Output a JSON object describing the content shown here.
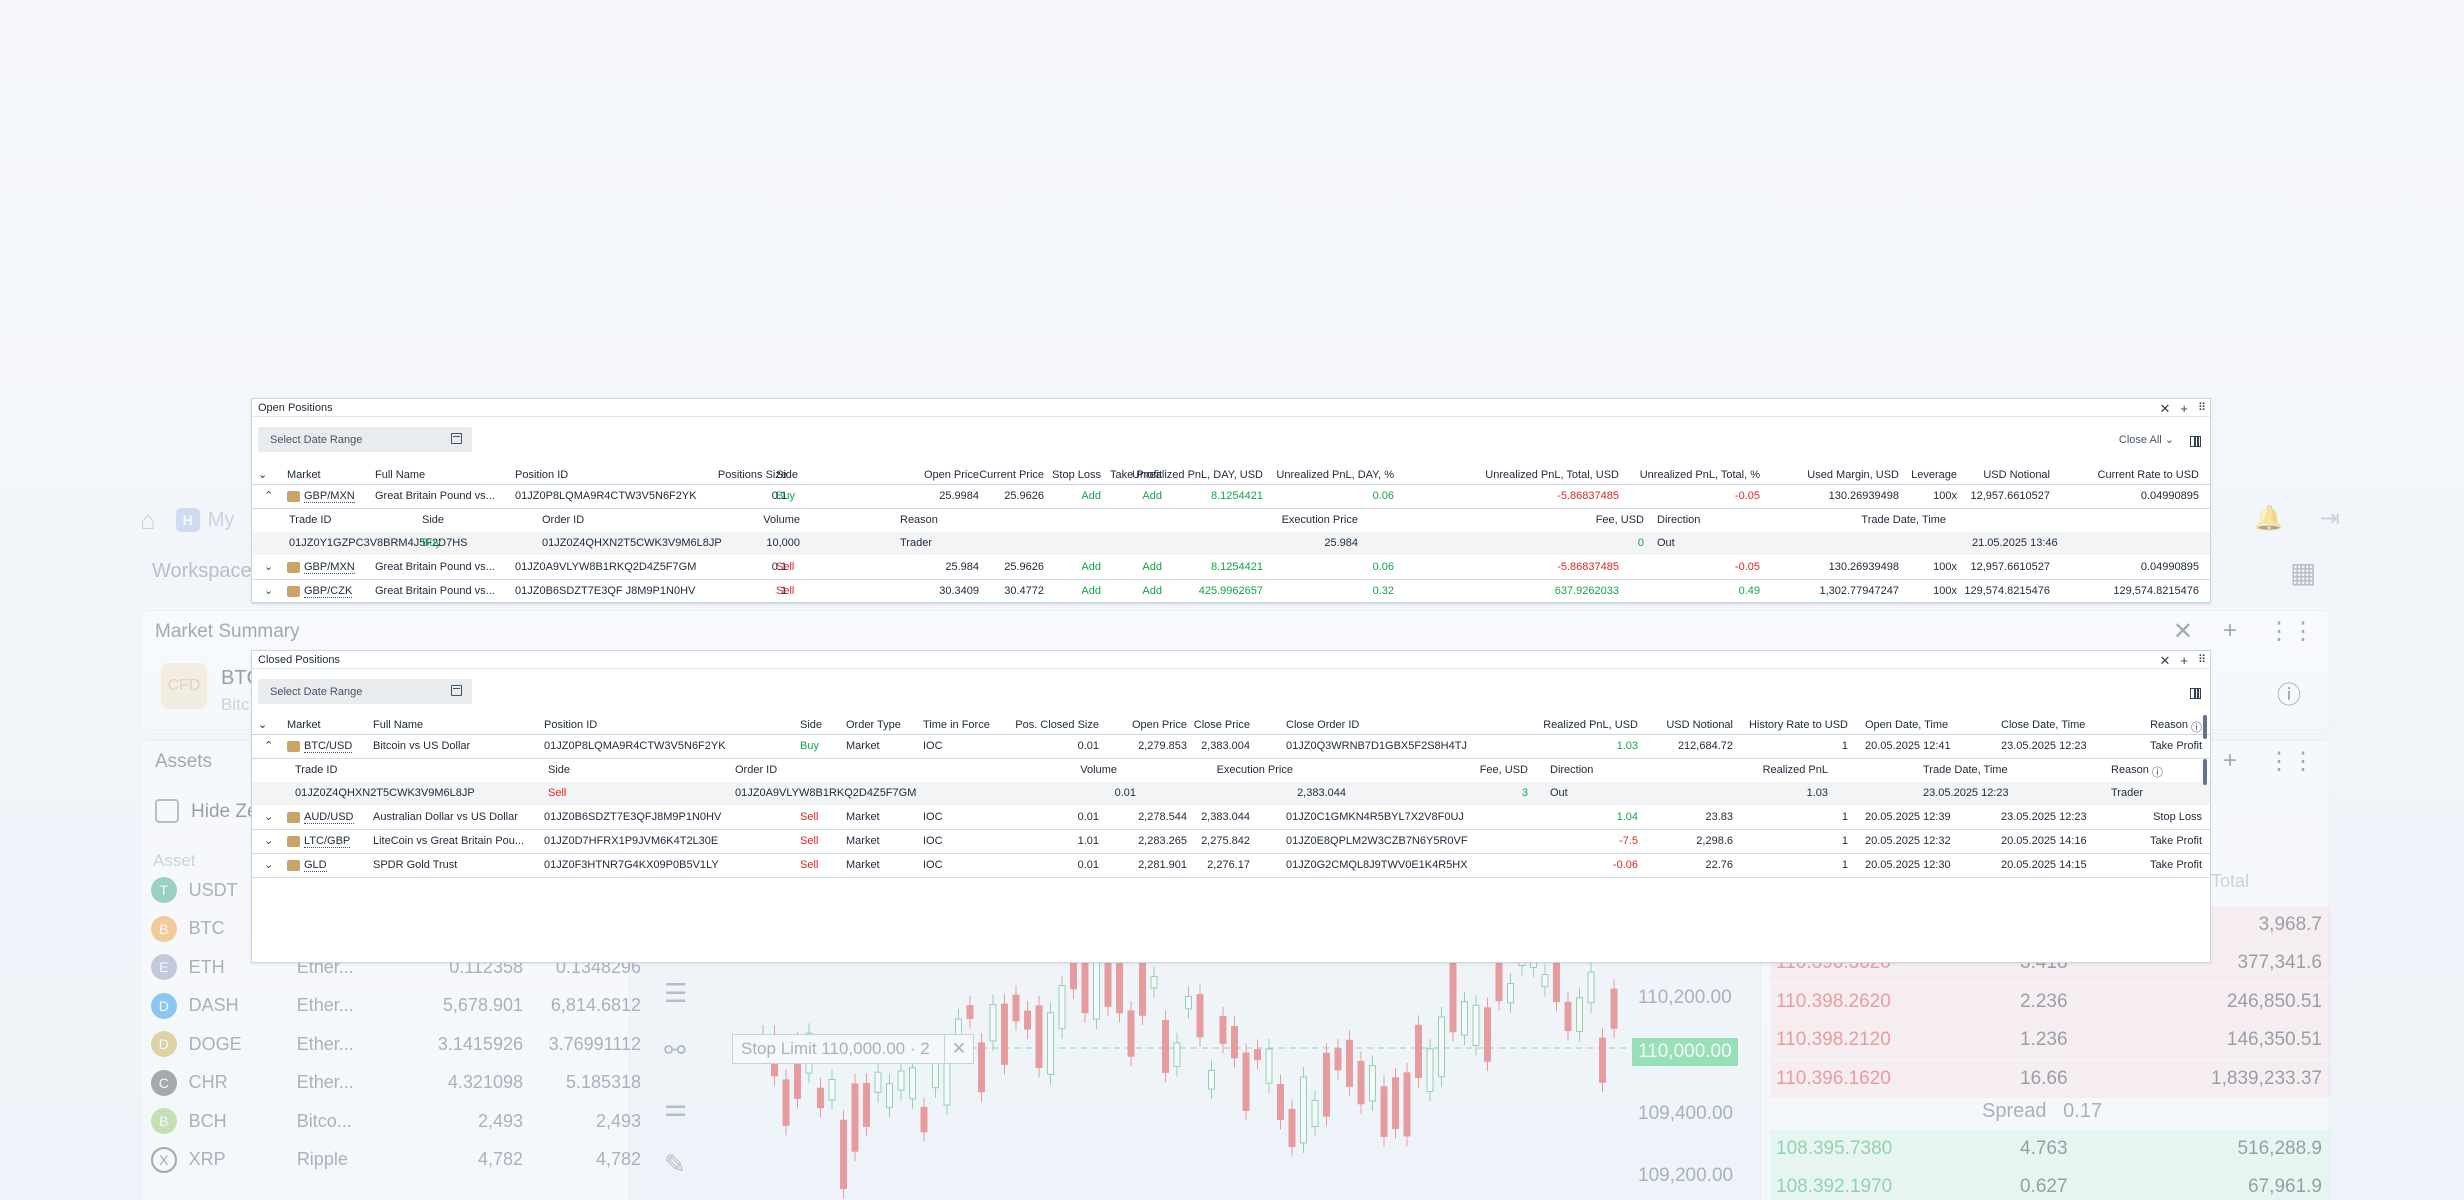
{
  "background": {
    "nav_my": "My",
    "workspace": "Workspace",
    "market_summary": "Market Summary",
    "summary_pair": "BTC",
    "summary_sub": "Bitc",
    "summary_badge": "CFD",
    "assets_title": "Assets",
    "hide_zero": "Hide Ze",
    "asset_col": "Asset",
    "total_col": "Total",
    "assets": [
      {
        "sym": "USDT",
        "net": "",
        "v1": "",
        "v2": "",
        "color": "#26a17b",
        "icon": "T"
      },
      {
        "sym": "BTC",
        "net": "",
        "v1": "",
        "v2": "",
        "color": "#f7931a",
        "icon": "B"
      },
      {
        "sym": "ETH",
        "net": "Ether...",
        "v1": "0.112358",
        "v2": "0.1348296",
        "color": "#8a92b2",
        "icon": "E"
      },
      {
        "sym": "DASH",
        "net": "Ether...",
        "v1": "5,678.901",
        "v2": "6,814.6812",
        "color": "#008ce7",
        "icon": "D"
      },
      {
        "sym": "DOGE",
        "net": "Ether...",
        "v1": "3.1415926",
        "v2": "3.76991112",
        "color": "#c2a633",
        "icon": "D"
      },
      {
        "sym": "CHR",
        "net": "Ether...",
        "v1": "4.321098",
        "v2": "5.185318",
        "color": "#444444",
        "icon": "C"
      },
      {
        "sym": "BCH",
        "net": "Bitco...",
        "v1": "2,493",
        "v2": "2,493",
        "color": "#8dc351",
        "icon": "B"
      },
      {
        "sym": "XRP",
        "net": "Ripple",
        "v1": "4,782",
        "v2": "4,782",
        "color": "#ffffff",
        "icon": "X"
      }
    ],
    "orderbook": [
      {
        "p": "",
        "q": "",
        "t": "3,968.7",
        "side": "ask"
      },
      {
        "p": "110.396.3620",
        "q": "3.418",
        "t": "377,341.6",
        "side": "ask"
      },
      {
        "p": "110.398.2620",
        "q": "2.236",
        "t": "246,850.51",
        "side": "ask"
      },
      {
        "p": "110.398.2120",
        "q": "1.236",
        "t": "146,350.51",
        "side": "ask"
      },
      {
        "p": "110.396.1620",
        "q": "16.66",
        "t": "1,839,233.37",
        "side": "ask"
      },
      {
        "p": "108.395.7380",
        "q": "4.763",
        "t": "516,288.9",
        "side": "bid"
      },
      {
        "p": "108.392.1970",
        "q": "0.627",
        "t": "67,961.9",
        "side": "bid"
      }
    ],
    "spread_label": "Spread",
    "spread_value": "0.17",
    "chart_prices": [
      "110,200.00",
      "110,000.00",
      "109,400.00",
      "109,200.00"
    ],
    "stop_limit_label": "Stop Limit 110,000.00 · 2"
  },
  "open_positions": {
    "title": "Open Positions",
    "date_range_placeholder": "Select Date Range",
    "close_all": "Close All",
    "headers": [
      "Market",
      "Full Name",
      "Position ID",
      "Side",
      "Positions Size",
      "Open Price",
      "Current Price",
      "Stop Loss",
      "Take Profit",
      "Unrealized PnL, DAY, USD",
      "Unrealized PnL, DAY, %",
      "Unrealized PnL, Total, USD",
      "Unrealized PnL, Total, %",
      "Used Margin, USD",
      "Leverage",
      "USD Notional",
      "Current Rate to USD"
    ],
    "rows": [
      {
        "market": "GBP/MXN",
        "full_name": "Great Britain Pound vs...",
        "position_id": "01JZ0P8LQMA9R4CTW3V5N6F2YK",
        "side": "Buy",
        "size": "0.1",
        "open_price": "25.9984",
        "current_price": "25.9626",
        "stop_loss": "Add",
        "take_profit": "Add",
        "pnl_day_usd": "8.1254421",
        "pnl_day_pct": "0.06",
        "pnl_total_usd": "-5.86837485",
        "pnl_total_pct": "-0.05",
        "used_margin": "130.26939498",
        "leverage": "100x",
        "usd_notional": "12,957.6610527",
        "rate": "0.04990895"
      },
      {
        "market": "GBP/MXN",
        "full_name": "Great Britain Pound vs...",
        "position_id": "01JZ0A9VLYW8B1RKQ2D4Z5F7GM",
        "side": "Sell",
        "size": "0.1",
        "open_price": "25.984",
        "current_price": "25.9626",
        "stop_loss": "Add",
        "take_profit": "Add",
        "pnl_day_usd": "8.1254421",
        "pnl_day_pct": "0.06",
        "pnl_total_usd": "-5.86837485",
        "pnl_total_pct": "-0.05",
        "used_margin": "130.26939498",
        "leverage": "100x",
        "usd_notional": "12,957.6610527",
        "rate": "0.04990895"
      },
      {
        "market": "GBP/CZK",
        "full_name": "Great Britain Pound vs...",
        "position_id": "01JZ0B6SDZT7E3QF J8M9P1N0HV",
        "side": "Sell",
        "size": "1",
        "open_price": "30.3409",
        "current_price": "30.4772",
        "stop_loss": "Add",
        "take_profit": "Add",
        "pnl_day_usd": "425.9962657",
        "pnl_day_pct": "0.32",
        "pnl_total_usd": "637.9262033",
        "pnl_total_pct": "0.49",
        "used_margin": "1,302.77947247",
        "leverage": "100x",
        "usd_notional": "129,574.8215476",
        "rate": "129,574.8215476"
      }
    ],
    "sub_headers": [
      "Trade ID",
      "Side",
      "Order ID",
      "Reason",
      "Volume",
      "Execution Price",
      "Fee, USD",
      "Direction",
      "Trade Date, Time"
    ],
    "sub_row": {
      "trade_id": "01JZ0Y1GZPC3V8BRM4J5F2D7HS",
      "side": "Buy",
      "order_id": "01JZ0Z4QHXN2T5CWK3V9M6L8JP",
      "reason": "Trader",
      "volume": "10,000",
      "exec_price": "25.984",
      "fee": "0",
      "direction": "Out",
      "datetime": "21.05.2025 13:46"
    }
  },
  "closed_positions": {
    "title": "Closed Positions",
    "date_range_placeholder": "Select Date Range",
    "headers": [
      "Market",
      "Full Name",
      "Position ID",
      "Side",
      "Order Type",
      "Time in Force",
      "Pos. Closed Size",
      "Open Price",
      "Close Price",
      "Close Order ID",
      "Realized PnL, USD",
      "USD Notional",
      "History Rate to USD",
      "Open Date, Time",
      "Close Date, Time",
      "Reason"
    ],
    "rows": [
      {
        "market": "BTC/USD",
        "full_name": "Bitcoin vs US Dollar",
        "position_id": "01JZ0P8LQMA9R4CTW3V5N6F2YK",
        "side": "Buy",
        "order_type": "Market",
        "tif": "IOC",
        "size": "0.01",
        "open_price": "2,279.853",
        "close_price": "2,383.004",
        "close_order_id": "01JZ0Q3WRNB7D1GBX5F2S8H4TJ",
        "pnl": "1.03",
        "notional": "212,684.72",
        "rate": "1",
        "open_dt": "20.05.2025 12:41",
        "close_dt": "23.05.2025 12:23",
        "reason": "Take Profit"
      },
      {
        "market": "AUD/USD",
        "full_name": "Australian Dollar vs US Dollar",
        "position_id": "01JZ0B6SDZT7E3QFJ8M9P1N0HV",
        "side": "Sell",
        "order_type": "Market",
        "tif": "IOC",
        "size": "0.01",
        "open_price": "2,278.544",
        "close_price": "2,383.044",
        "close_order_id": "01JZ0C1GMKN4R5BYL7X2V8F0UJ",
        "pnl": "1.04",
        "notional": "23.83",
        "rate": "1",
        "open_dt": "20.05.2025 12:39",
        "close_dt": "23.05.2025 12:23",
        "reason": "Stop Loss"
      },
      {
        "market": "LTC/GBP",
        "full_name": "LiteCoin vs Great Britain Pou...",
        "position_id": "01JZ0D7HFRX1P9JVM6K4T2L30E",
        "side": "Sell",
        "order_type": "Market",
        "tif": "IOC",
        "size": "1.01",
        "open_price": "2,283.265",
        "close_price": "2,275.842",
        "close_order_id": "01JZ0E8QPLM2W3CZB7N6Y5R0VF",
        "pnl": "-7.5",
        "notional": "2,298.6",
        "rate": "1",
        "open_dt": "20.05.2025 12:32",
        "close_dt": "20.05.2025 14:16",
        "reason": "Take Profit"
      },
      {
        "market": "GLD",
        "full_name": "SPDR Gold Trust",
        "position_id": "01JZ0F3HTNR7G4KX09P0B5V1LY",
        "side": "Sell",
        "order_type": "Market",
        "tif": "IOC",
        "size": "0.01",
        "open_price": "2,281.901",
        "close_price": "2,276.17",
        "close_order_id": "01JZ0G2CMQL8J9TWV0E1K4R5HX",
        "pnl": "-0.06",
        "notional": "22.76",
        "rate": "1",
        "open_dt": "20.05.2025 12:30",
        "close_dt": "20.05.2025 14:15",
        "reason": "Take Profit"
      }
    ],
    "sub_headers": [
      "Trade ID",
      "Side",
      "Order ID",
      "Volume",
      "Execution Price",
      "Fee, USD",
      "Direction",
      "Realized PnL",
      "Trade Date, Time",
      "Reason"
    ],
    "sub_row": {
      "trade_id": "01JZ0Z4QHXN2T5CWK3V9M6L8JP",
      "side": "Sell",
      "order_id": "01JZ0A9VLYW8B1RKQ2D4Z5F7GM",
      "volume": "0.01",
      "exec_price": "2,383.044",
      "fee": "3",
      "direction": "Out",
      "realized_pnl": "1.03",
      "datetime": "23.05.2025 12:23",
      "reason": "Trader"
    }
  }
}
